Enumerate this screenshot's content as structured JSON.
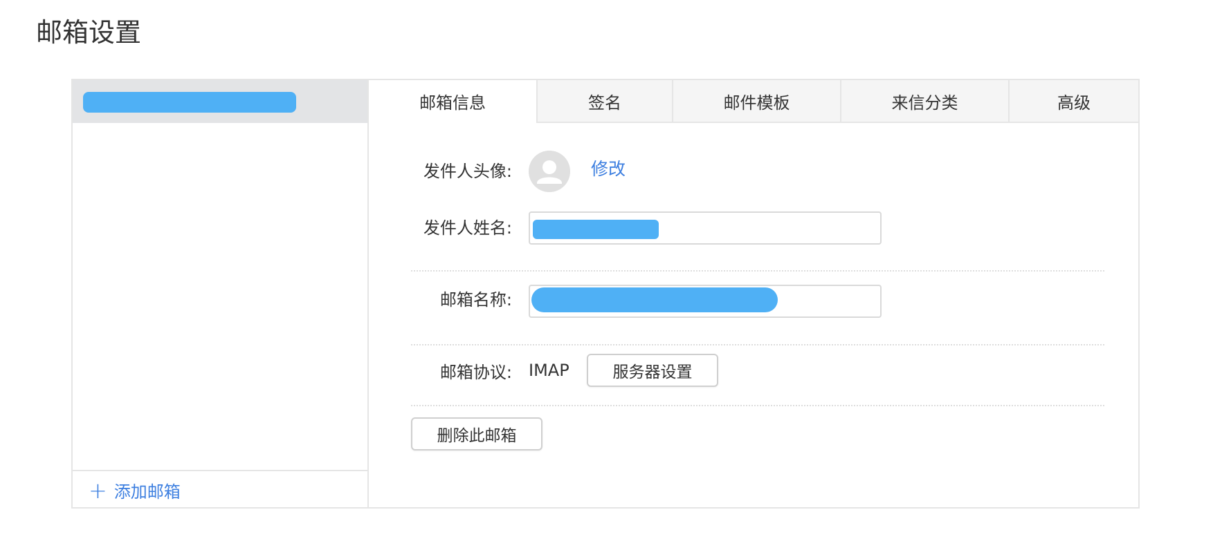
{
  "page": {
    "title": "邮箱设置"
  },
  "sidebar": {
    "selected_account_label": "",
    "add_mailbox_icon": "plus-icon",
    "add_mailbox_label": "添加邮箱"
  },
  "tabs": [
    {
      "label": "邮箱信息",
      "active": true
    },
    {
      "label": "签名",
      "active": false
    },
    {
      "label": "邮件模板",
      "active": false
    },
    {
      "label": "来信分类",
      "active": false
    },
    {
      "label": "高级",
      "active": false
    }
  ],
  "form": {
    "avatar": {
      "label": "发件人头像:",
      "icon": "user-avatar-icon",
      "modify_label": "修改"
    },
    "sender_name": {
      "label": "发件人姓名:",
      "value": ""
    },
    "mailbox_name": {
      "label": "邮箱名称:",
      "value": ""
    },
    "protocol": {
      "label": "邮箱协议:",
      "value": "IMAP",
      "server_settings_label": "服务器设置"
    },
    "delete_label": "删除此邮箱"
  },
  "colors": {
    "accent": "#3d7fe0",
    "redaction": "#4fb0f5",
    "border": "#e5e5e5",
    "selected_row_bg": "#e3e4e6",
    "tab_bg": "#f5f5f5"
  }
}
